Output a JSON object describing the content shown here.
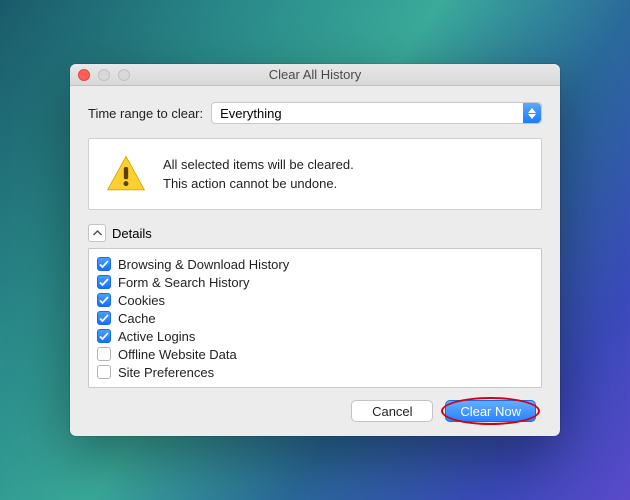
{
  "window": {
    "title": "Clear All History"
  },
  "range": {
    "label": "Time range to clear:",
    "value": "Everything"
  },
  "warning": {
    "line1": "All selected items will be cleared.",
    "line2": "This action cannot be undone."
  },
  "details": {
    "label": "Details",
    "items": [
      {
        "label": "Browsing & Download History",
        "checked": true
      },
      {
        "label": "Form & Search History",
        "checked": true
      },
      {
        "label": "Cookies",
        "checked": true
      },
      {
        "label": "Cache",
        "checked": true
      },
      {
        "label": "Active Logins",
        "checked": true
      },
      {
        "label": "Offline Website Data",
        "checked": false
      },
      {
        "label": "Site Preferences",
        "checked": false
      }
    ]
  },
  "buttons": {
    "cancel": "Cancel",
    "clear": "Clear Now"
  }
}
